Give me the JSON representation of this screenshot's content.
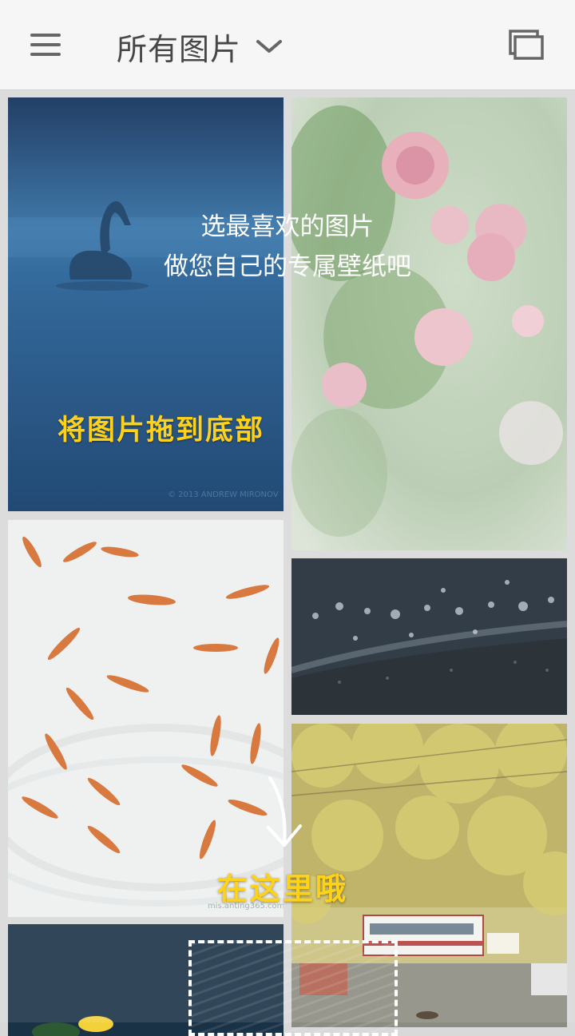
{
  "toolbar": {
    "title": "所有图片",
    "menu_icon": "hamburger-menu-icon",
    "dropdown_icon": "chevron-down-icon",
    "switch_icon": "stacked-windows-icon"
  },
  "onboarding": {
    "line1": "选最喜欢的图片",
    "line2": "做您自己的专属壁纸吧",
    "drag_hint": "将图片拖到底部",
    "drop_hint": "在这里哦",
    "accent_color": "#ffd21a"
  },
  "gallery": {
    "items": [
      {
        "subject": "swan on blue lake",
        "caption": "© 2013 ANDREW MIRONOV"
      },
      {
        "subject": "pink roses"
      },
      {
        "subject": "goldfish"
      },
      {
        "subject": "bokeh lights at night"
      },
      {
        "subject": "yellow tree lined street with bus"
      },
      {
        "subject": "night flowers"
      }
    ],
    "watermark": "mis.anting365.com"
  }
}
